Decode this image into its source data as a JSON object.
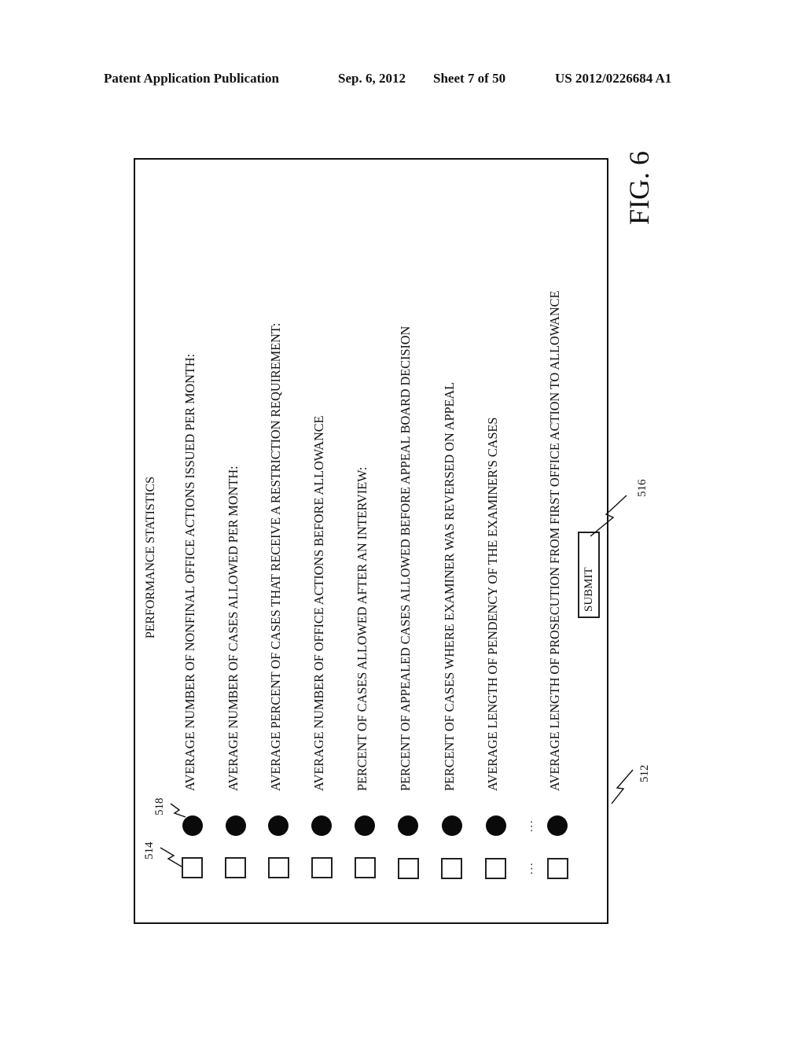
{
  "header": {
    "publication": "Patent Application Publication",
    "date": "Sep. 6, 2012",
    "sheet": "Sheet 7 of 50",
    "number": "US 2012/0226684 A1"
  },
  "figure": {
    "title": "PERFORMANCE STATISTICS",
    "label": "FIG. 6",
    "items": [
      {
        "label": "AVERAGE NUMBER OF NONFINAL OFFICE ACTIONS ISSUED PER MONTH:"
      },
      {
        "label": "AVERAGE NUMBER OF CASES ALLOWED PER MONTH:"
      },
      {
        "label": "AVERAGE PERCENT OF CASES THAT RECEIVE A RESTRICTION REQUIREMENT:"
      },
      {
        "label": "AVERAGE NUMBER OF OFFICE ACTIONS BEFORE ALLOWANCE"
      },
      {
        "label": "PERCENT OF CASES ALLOWED AFTER AN INTERVIEW:"
      },
      {
        "label": "PERCENT OF APPEALED CASES ALLOWED BEFORE APPEAL BOARD DECISION"
      },
      {
        "label": "PERCENT OF CASES WHERE EXAMINER WAS REVERSED ON APPEAL"
      },
      {
        "label": "AVERAGE LENGTH OF PENDENCY OF THE EXAMINER'S CASES"
      },
      {
        "label": "AVERAGE LENGTH OF PROSECUTION FROM FIRST OFFICE ACTION TO ALLOWANCE"
      }
    ],
    "ellipsis": "...",
    "submit_label": "SUBMIT",
    "refs": {
      "frame": "512",
      "checkbox": "514",
      "submit": "516",
      "radio": "518"
    }
  }
}
